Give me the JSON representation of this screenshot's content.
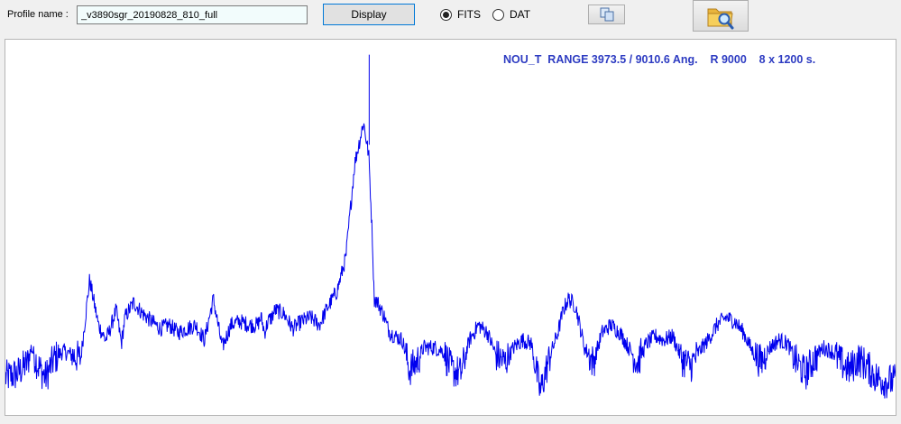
{
  "toolbar": {
    "profile_label": "Profile name :",
    "profile_value": "_v3890sgr_20190828_810_full",
    "display_label": "Display",
    "format_options": [
      {
        "label": "FITS",
        "selected": true
      },
      {
        "label": "DAT",
        "selected": false
      }
    ],
    "copy_icon": "copy-icon",
    "open_icon": "folder-search-icon"
  },
  "plot": {
    "title": "NOU_T  RANGE 3973.5 / 9010.6 Ang.    R 9000    8 x 1200 s.",
    "line_color": "#0000ee",
    "title_color": "#2e3cc2"
  },
  "chart_data": {
    "type": "line",
    "title": "NOU_T  RANGE 3973.5 / 9010.6 Ang.    R 9000    8 x 1200 s.",
    "xlabel": "",
    "ylabel": "",
    "xlim": [
      3973.5,
      9010.6
    ],
    "ylim": [
      0,
      1
    ],
    "grid": false,
    "legend": "none",
    "series": [
      {
        "x": [
          3973.5,
          4040,
          4100,
          4120,
          4160,
          4200,
          4250,
          4300,
          4350,
          4400,
          4450,
          4500,
          4540,
          4560,
          4600,
          4630,
          4650,
          4700,
          4750,
          4800,
          4850,
          4900,
          4950,
          5000,
          5050,
          5100,
          5150,
          5200,
          5250,
          5300,
          5350,
          5400,
          5420,
          5440,
          5460,
          5480,
          5500,
          5550,
          5600,
          5650,
          5700,
          5750,
          5800,
          5850,
          5900,
          5950,
          6000,
          6030,
          6050,
          6060,
          6080,
          6100,
          6120,
          6130,
          6150,
          6180,
          6220,
          6260,
          6300,
          6340,
          6400,
          6450,
          6500,
          6550,
          6600,
          6650,
          6700,
          6750,
          6800,
          6850,
          6900,
          6950,
          7000,
          7050,
          7100,
          7130,
          7160,
          7200,
          7250,
          7300,
          7350,
          7400,
          7450,
          7500,
          7550,
          7600,
          7650,
          7700,
          7750,
          7800,
          7850,
          7900,
          7950,
          8000,
          8050,
          8100,
          8150,
          8200,
          8250,
          8300,
          8350,
          8400,
          8450,
          8500,
          8550,
          8600,
          8650,
          8700,
          8750,
          8800,
          8850,
          8900,
          8950,
          9010.6
        ],
        "y": [
          0.1,
          0.11,
          0.14,
          0.18,
          0.13,
          0.1,
          0.15,
          0.17,
          0.16,
          0.15,
          0.36,
          0.24,
          0.2,
          0.22,
          0.28,
          0.19,
          0.26,
          0.3,
          0.27,
          0.25,
          0.23,
          0.24,
          0.22,
          0.23,
          0.24,
          0.2,
          0.31,
          0.18,
          0.24,
          0.25,
          0.24,
          0.24,
          0.26,
          0.22,
          0.25,
          0.26,
          0.28,
          0.27,
          0.23,
          0.25,
          0.26,
          0.24,
          0.29,
          0.33,
          0.42,
          0.67,
          0.78,
          0.69,
          0.47,
          0.31,
          0.3,
          0.28,
          0.26,
          0.24,
          0.22,
          0.21,
          0.2,
          0.12,
          0.14,
          0.18,
          0.18,
          0.17,
          0.12,
          0.11,
          0.2,
          0.24,
          0.22,
          0.16,
          0.14,
          0.18,
          0.2,
          0.19,
          0.06,
          0.15,
          0.22,
          0.28,
          0.31,
          0.29,
          0.18,
          0.14,
          0.22,
          0.24,
          0.22,
          0.18,
          0.14,
          0.19,
          0.21,
          0.2,
          0.21,
          0.15,
          0.13,
          0.17,
          0.2,
          0.24,
          0.26,
          0.25,
          0.22,
          0.17,
          0.14,
          0.18,
          0.2,
          0.19,
          0.14,
          0.11,
          0.15,
          0.18,
          0.17,
          0.14,
          0.12,
          0.15,
          0.13,
          0.1,
          0.09,
          0.09
        ]
      }
    ],
    "features": [
      {
        "x": 6032,
        "peak": 0.96,
        "width": 3
      }
    ]
  }
}
